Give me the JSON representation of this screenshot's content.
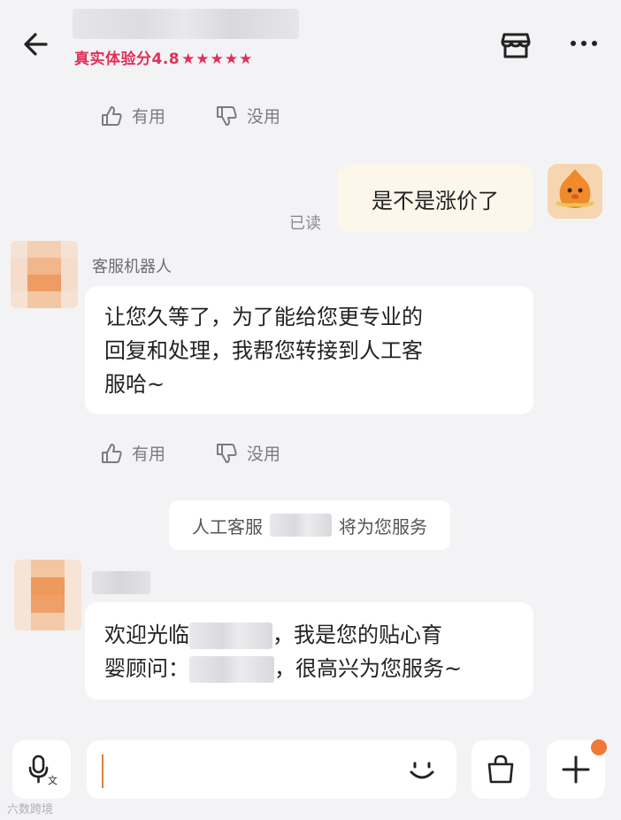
{
  "header": {
    "rating_text": "真实体验分4.8",
    "stars": "★★★★★",
    "accent_color": "#e0305a"
  },
  "icons": {
    "back": "arrow-left-icon",
    "store": "store-icon",
    "more": "more-dots-icon",
    "thumb_up": "thumb-up-icon",
    "thumb_down": "thumb-down-icon",
    "voice": "microphone-translate-icon",
    "emoji": "smile-icon",
    "bag": "shopping-bag-icon",
    "plus": "plus-icon"
  },
  "feedback": {
    "useful": "有用",
    "useless": "没用"
  },
  "messages": {
    "user_message": "是不是涨价了",
    "read_status": "已读",
    "bot_sender": "客服机器人",
    "bot_lines": [
      "让您久等了，为了能给您更专业的",
      "回复和处理，我帮您转接到人工客",
      "服哈~"
    ],
    "system_prefix": "人工客服",
    "system_suffix": "将为您服务",
    "agent_line1_a": "欢迎光临",
    "agent_line1_b": "，我是您的贴心育",
    "agent_line2_a": "婴顾问：",
    "agent_line2_b": "，很高兴为您服务~"
  },
  "watermark": "六数跨境"
}
